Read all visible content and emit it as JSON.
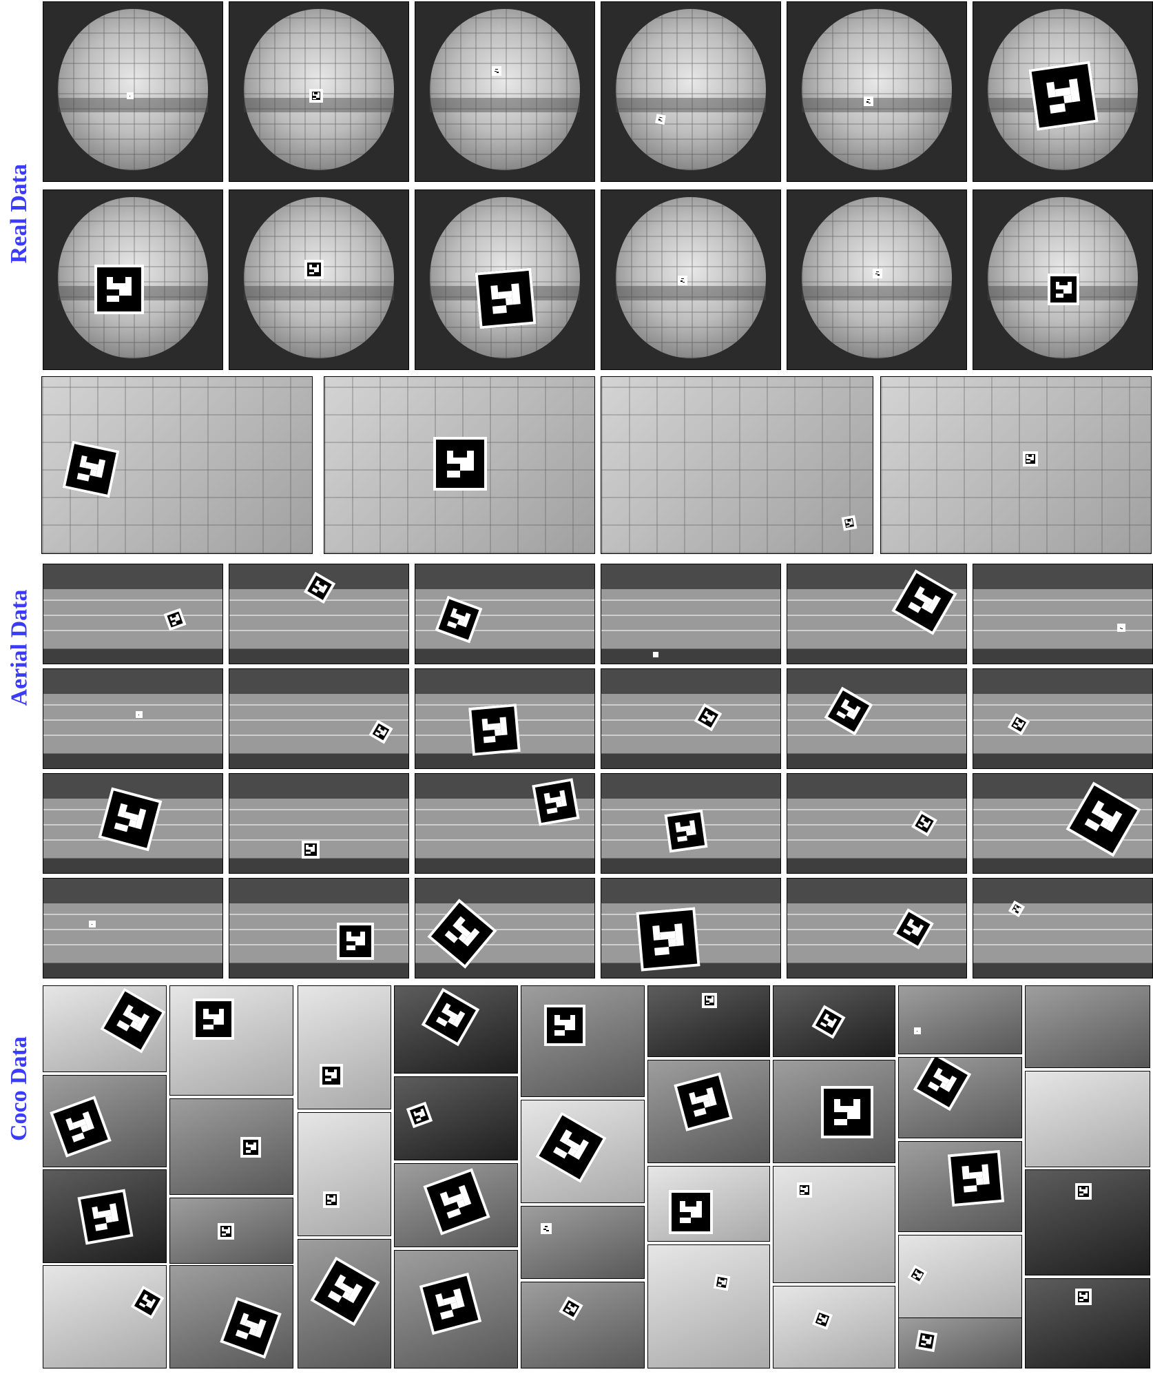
{
  "sections": {
    "real_label": "Real Data",
    "aerial_label": "Aerial Data",
    "coco_label": "Coco Data"
  },
  "colors": {
    "label": "#3b3bff",
    "background": "#ffffff"
  },
  "icons": [
    "fiducial-marker-icon"
  ]
}
